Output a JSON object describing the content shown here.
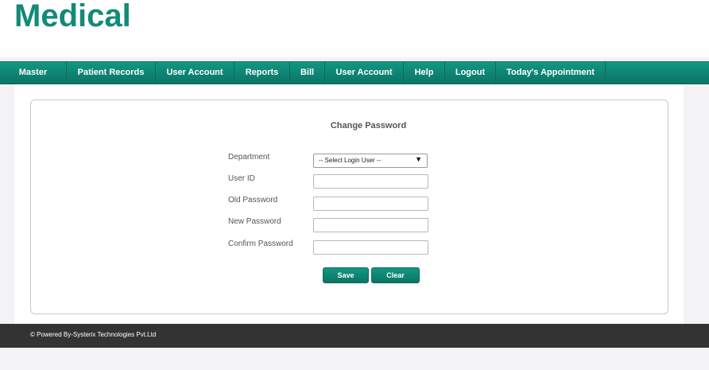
{
  "brand": {
    "logo": "Medical"
  },
  "nav": {
    "items": [
      {
        "label": "Master"
      },
      {
        "label": "Patient Records"
      },
      {
        "label": "User Account"
      },
      {
        "label": "Reports"
      },
      {
        "label": "Bill"
      },
      {
        "label": "User Account"
      },
      {
        "label": "Help"
      },
      {
        "label": "Logout"
      },
      {
        "label": "Today's Appointment"
      }
    ]
  },
  "form": {
    "title": "Change Password",
    "department_label": "Department",
    "department_selected": "-- Select Login User --",
    "userid_label": "User ID",
    "userid_value": "",
    "oldpw_label": "Old Password",
    "oldpw_value": "",
    "newpw_label": "New Password",
    "newpw_value": "",
    "confirmpw_label": "Confirm Password",
    "confirmpw_value": "",
    "save_label": "Save",
    "clear_label": "Clear",
    "dropdown_icon": "dropdown-arrow-icon"
  },
  "footer": {
    "text": "© Powered By-Systerix Technologies Pvt.Ltd"
  },
  "colors": {
    "brand": "#128a78",
    "nav_bg": "#0d8171",
    "footer_bg": "#333333"
  }
}
